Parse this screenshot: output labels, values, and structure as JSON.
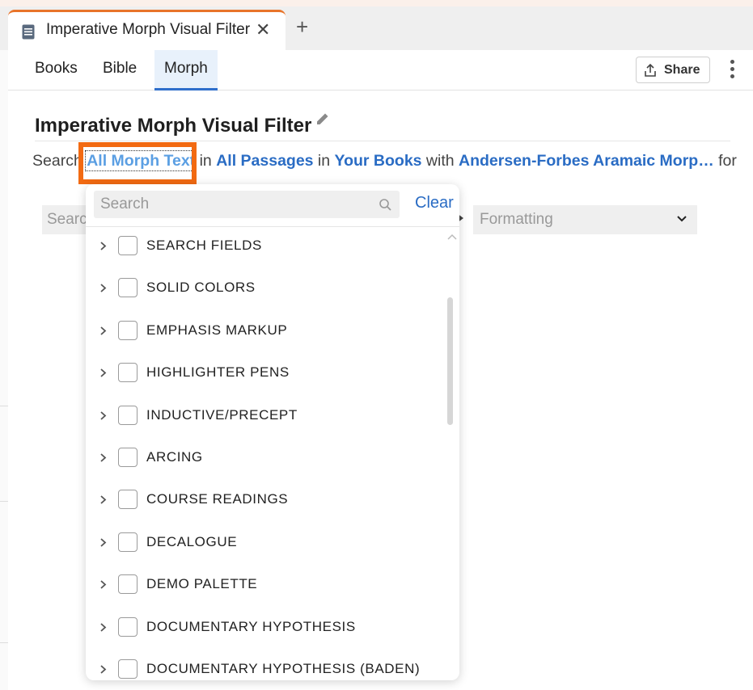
{
  "tab": {
    "title": "Imperative Morph Visual Filter",
    "close": "✕",
    "new": "+"
  },
  "nav": {
    "items": [
      "Books",
      "Bible",
      "Morph"
    ],
    "active": "Morph",
    "share": "Share"
  },
  "page": {
    "title": "Imperative Morph Visual Filter"
  },
  "search_line": {
    "prefix": "Search ",
    "text_scope": "All Morph Text",
    "in1": " in ",
    "passages": "All Passages",
    "in2": " in ",
    "books": "Your Books",
    "with": " with ",
    "morph_db": "Andersen-Forbes Aramaic Morp…",
    "for": " for"
  },
  "background": {
    "field1": "Search",
    "field2": "Formatting"
  },
  "dropdown": {
    "search_placeholder": "Search",
    "clear": "Clear",
    "items": [
      "SEARCH FIELDS",
      "SOLID COLORS",
      "EMPHASIS MARKUP",
      "HIGHLIGHTER PENS",
      "INDUCTIVE/PRECEPT",
      "ARCING",
      "COURSE READINGS",
      "DECALOGUE",
      "DEMO PALETTE",
      "DOCUMENTARY HYPOTHESIS",
      "DOCUMENTARY HYPOTHESIS (BADEN)"
    ]
  },
  "colors": {
    "accent": "#2a6cc4",
    "highlight": "#f26a12",
    "tab_accent": "#e8742a"
  }
}
